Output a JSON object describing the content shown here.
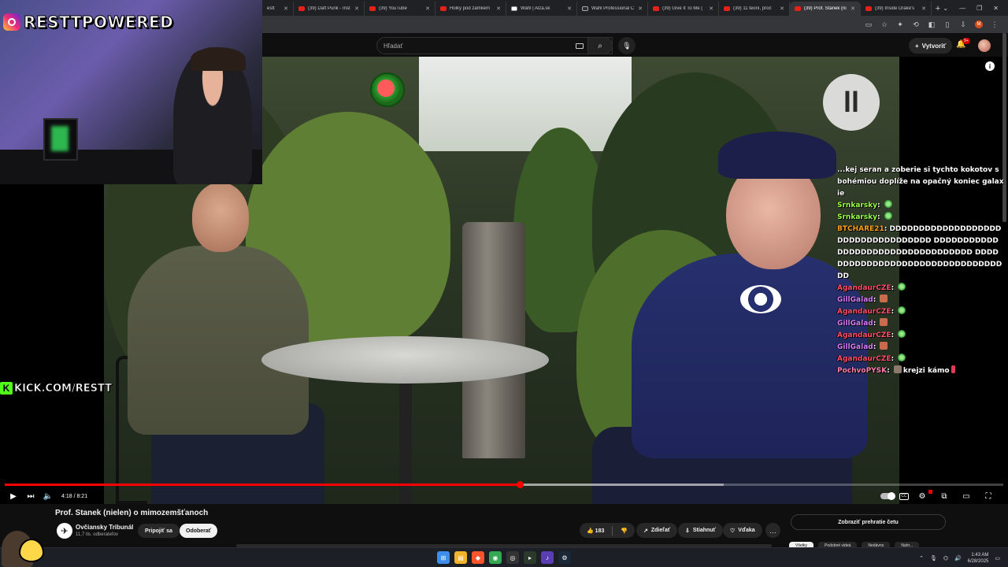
{
  "browser": {
    "tabs": [
      {
        "title": "estt",
        "favicon": "youtube",
        "active": false
      },
      {
        "title": "(39) Daft Punk - Inst",
        "favicon": "youtube",
        "active": false
      },
      {
        "title": "(39) YouTube",
        "favicon": "youtube",
        "active": false
      },
      {
        "title": "Holky pod zámkem",
        "favicon": "youtube",
        "active": false
      },
      {
        "title": "Wahl | Alza.sk",
        "favicon": "alza",
        "active": false
      },
      {
        "title": "Wahl Professional C",
        "favicon": "page",
        "active": false
      },
      {
        "title": "(39) Give It To Me (",
        "favicon": "youtube",
        "active": false
      },
      {
        "title": "(39) 11 teorií, proč",
        "favicon": "youtube",
        "active": false
      },
      {
        "title": "(39) Prof. Stanek (ni",
        "favicon": "youtube",
        "active": true
      },
      {
        "title": "(39) Inside Drake's ",
        "favicon": "youtube",
        "active": false
      }
    ],
    "new_tab": "+",
    "profile_initial": "M"
  },
  "header": {
    "search_placeholder": "Hľadať",
    "create_label": "Vytvoriť",
    "notifications_badge": "9+"
  },
  "stream_overlay": {
    "instagram_handle": "RESTTPOWERED",
    "kick_handle": "KICK.COM/RESTT",
    "kick_letter": "K"
  },
  "watermark": {
    "letters": "ll"
  },
  "chat": [
    {
      "user": "",
      "user_color": "#ffffff",
      "text": "...kej seran a zoberie si tychto kokotov s bohémiou doplíže na opačný koniec galaxie",
      "emotes": []
    },
    {
      "user": "Srnkarsky",
      "user_color": "#9cff4a",
      "text": "",
      "emotes": [
        "green"
      ]
    },
    {
      "user": "Srnkarsky",
      "user_color": "#9cff4a",
      "text": "",
      "emotes": [
        "green"
      ]
    },
    {
      "user": "BTCHARE21",
      "user_color": "#ff9f1a",
      "text": "DDDDDDDDDDDDDDDDDDDDDDDDDDDDDDDDDDD DDDDDDDDDDDDDDDDDDDDDDDDDDDDDDDDDD DDDDDDDDDDDDDDDDDDDDDDDDDDDDDDDDDD",
      "emotes": []
    },
    {
      "user": "AgandaurCZE",
      "user_color": "#ff4f6a",
      "text": "",
      "emotes": [
        "green"
      ]
    },
    {
      "user": "GillGalad",
      "user_color": "#d77cff",
      "text": "",
      "emotes": [
        "pepe"
      ]
    },
    {
      "user": "AgandaurCZE",
      "user_color": "#ff4f6a",
      "text": "",
      "emotes": [
        "green"
      ]
    },
    {
      "user": "GillGalad",
      "user_color": "#d77cff",
      "text": "",
      "emotes": [
        "pepe"
      ]
    },
    {
      "user": "AgandaurCZE",
      "user_color": "#ff4f6a",
      "text": "",
      "emotes": [
        "green"
      ]
    },
    {
      "user": "GillGalad",
      "user_color": "#d77cff",
      "text": "",
      "emotes": [
        "pepe"
      ]
    },
    {
      "user": "AgandaurCZE",
      "user_color": "#ff4f6a",
      "text": "",
      "emotes": [
        "green"
      ]
    },
    {
      "user": "PochvoPYSK",
      "user_color": "#ff7fb0",
      "text": "krejzi kámo",
      "emotes": [
        "cat",
        "fire"
      ]
    }
  ],
  "player": {
    "time_current": "4:18",
    "time_total": "8:21",
    "time_display": "4:18 / 8:21",
    "progress_fraction": 0.516,
    "buffered_fraction": 0.72
  },
  "video": {
    "title": "Prof. Stanek (nielen) o mimozemšťanoch",
    "channel_name": "Ovčiansky Tribunál",
    "subscribers": "11,7 tis. odberateľov",
    "join_label": "Pripojiť sa",
    "subscribe_label": "Odoberať",
    "like_count": "183",
    "share_label": "Zdieľať",
    "download_label": "Stiahnuť",
    "thanks_label": "Vďaka",
    "more_label": "…"
  },
  "sidebar": {
    "chat_replay_label": "Zobraziť prehratie četu",
    "chips": [
      "Všetky",
      "Podobné videá",
      "Nedávno",
      "Nahr..."
    ]
  },
  "taskbar": {
    "time": "1:43 AM",
    "date": "6/28/2025"
  },
  "colors": {
    "accent": "#ff0000",
    "background": "#0f0f0f",
    "kick_green": "#53fc18"
  }
}
